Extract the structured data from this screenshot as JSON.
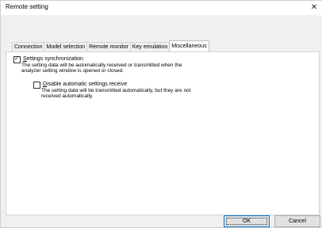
{
  "window": {
    "title": "Remote setting",
    "close_glyph": "✕"
  },
  "tabs": [
    {
      "label": "Connection"
    },
    {
      "label": "Model selection"
    },
    {
      "label": "Remote monitor"
    },
    {
      "label": "Key emulation"
    },
    {
      "label": "Miscellaneous",
      "active": true
    }
  ],
  "settings_sync": {
    "checked": true,
    "label_first": "S",
    "label_rest": "ettings synchronization",
    "desc_line1": "The setting data will be automatically received or transmitted when the",
    "desc_line2": "analyzer setting window is opened or closed."
  },
  "disable_receive": {
    "checked": false,
    "label_first": "D",
    "label_rest": "isable automatic settings receive",
    "desc_line1": "The setting data will be transmitted automatically, but they are not",
    "desc_line2": "received automatically."
  },
  "buttons": {
    "ok": "OK",
    "cancel": "Cancel"
  }
}
